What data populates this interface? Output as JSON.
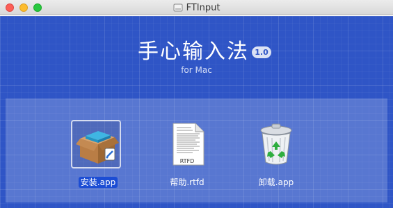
{
  "window": {
    "title": "FTInput"
  },
  "header": {
    "app_name": "手心输入法",
    "version": "1.0",
    "platform": "for Mac"
  },
  "files": [
    {
      "label": "安装.app",
      "icon": "package-installer-icon",
      "selected": true
    },
    {
      "label": "帮助.rtfd",
      "icon": "rtfd-document-icon",
      "selected": false,
      "icon_caption": "RTFD"
    },
    {
      "label": "卸载.app",
      "icon": "recycle-bin-icon",
      "selected": false
    }
  ],
  "colors": {
    "background": "#2f55c6",
    "selection": "#1c4dd4"
  }
}
